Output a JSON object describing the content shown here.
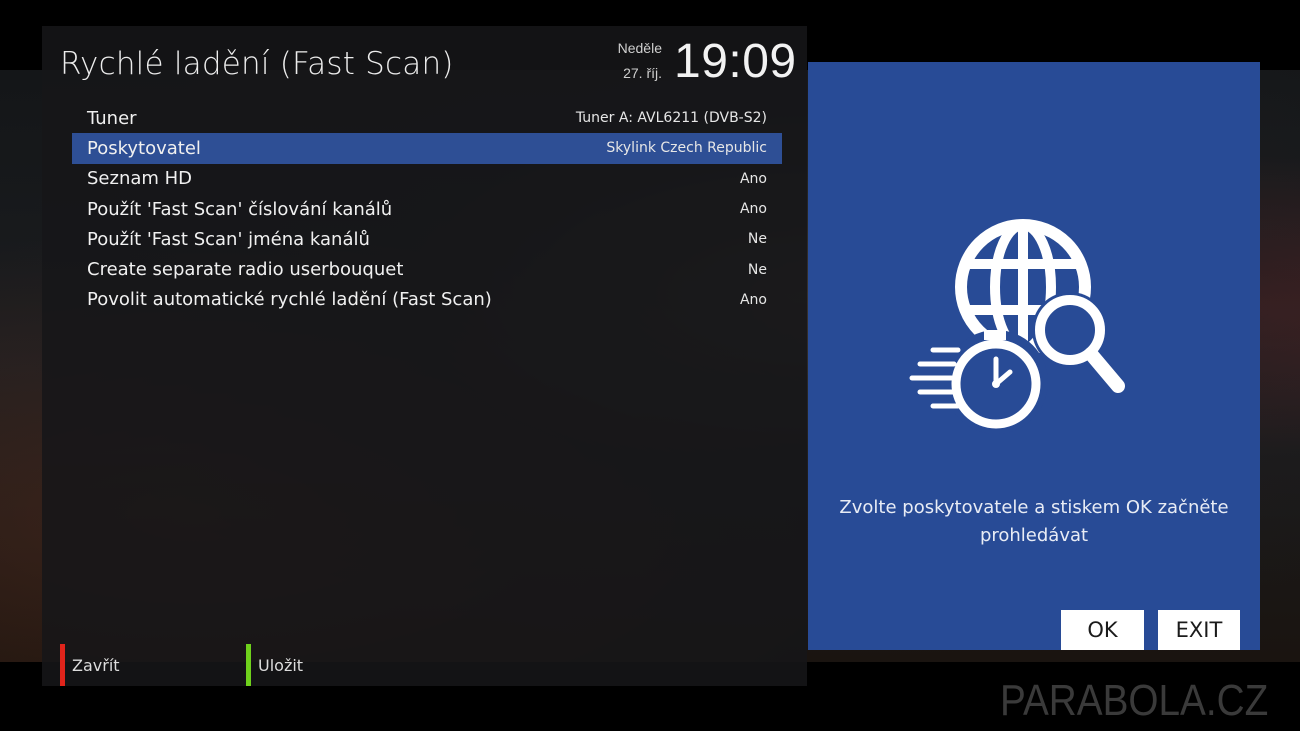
{
  "header": {
    "title": "Rychlé ladění (Fast Scan)",
    "day": "Neděle",
    "date": "27. říj.",
    "time": "19:09"
  },
  "settings": [
    {
      "label": "Tuner",
      "value": "Tuner A: AVL6211 (DVB-S2)",
      "selected": false
    },
    {
      "label": "Poskytovatel",
      "value": "Skylink Czech Republic",
      "selected": true
    },
    {
      "label": "Seznam HD",
      "value": "Ano",
      "selected": false
    },
    {
      "label": "Použít 'Fast Scan' číslování kanálů",
      "value": "Ano",
      "selected": false
    },
    {
      "label": "Použít 'Fast Scan' jména kanálů",
      "value": "Ne",
      "selected": false
    },
    {
      "label": "Create separate radio userbouquet",
      "value": "Ne",
      "selected": false
    },
    {
      "label": "Povolit automatické rychlé ladění (Fast Scan)",
      "value": "Ano",
      "selected": false
    }
  ],
  "footer": {
    "red_label": "Zavřít",
    "green_label": "Uložit"
  },
  "info": {
    "icon": "globe-search-stopwatch-icon",
    "text": "Zvolte poskytovatele a stiskem OK začněte prohledávat",
    "ok_label": "OK",
    "exit_label": "EXIT"
  },
  "watermark": "PARABOLA.CZ",
  "colors": {
    "selection": "#2e4f95",
    "info_panel": "#284b96",
    "red_key": "#e0241b",
    "green_key": "#6fd11c"
  }
}
